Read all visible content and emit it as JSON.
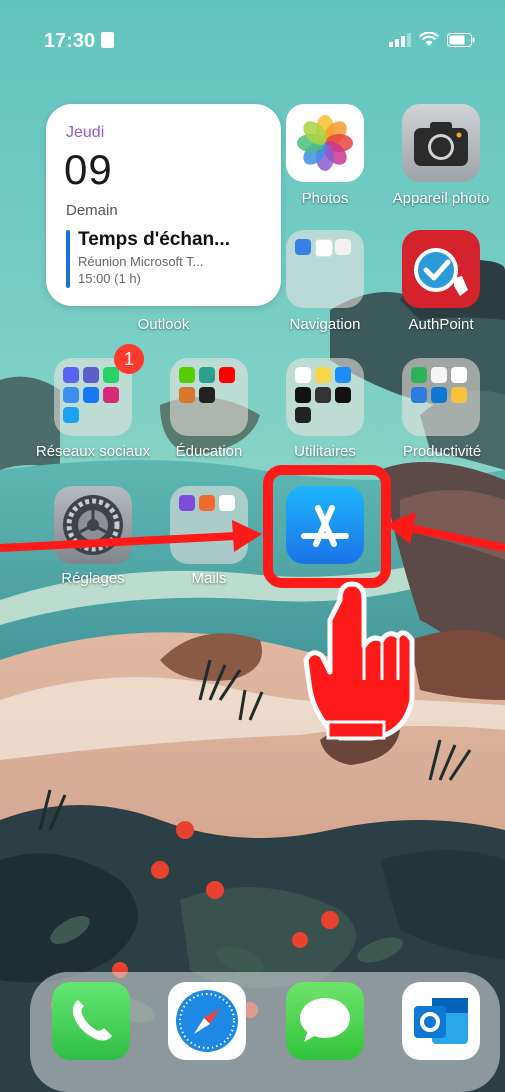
{
  "status_bar": {
    "time": "17:30"
  },
  "widget": {
    "app": "Outlook",
    "day": "Jeudi",
    "date": "09",
    "subtitle": "Demain",
    "event_title": "Temps d'échan...",
    "event_detail": "Réunion Microsoft T...",
    "event_time": "15:00 (1 h)"
  },
  "apps": {
    "photos": "Photos",
    "camera": "Appareil photo",
    "navigation": "Navigation",
    "authpoint": "AuthPoint",
    "social": "Réseaux sociaux",
    "education": "Éducation",
    "utilities": "Utilitaires",
    "productivity": "Productivité",
    "settings": "Réglages",
    "mails": "Mails"
  },
  "badges": {
    "social": "1"
  },
  "dock": [
    "Téléphone",
    "Safari",
    "Messages",
    "Outlook"
  ],
  "colors": {
    "highlight": "#ff1a1a",
    "accent": "#8e5ad6",
    "outlook_blue": "#1676d4"
  }
}
